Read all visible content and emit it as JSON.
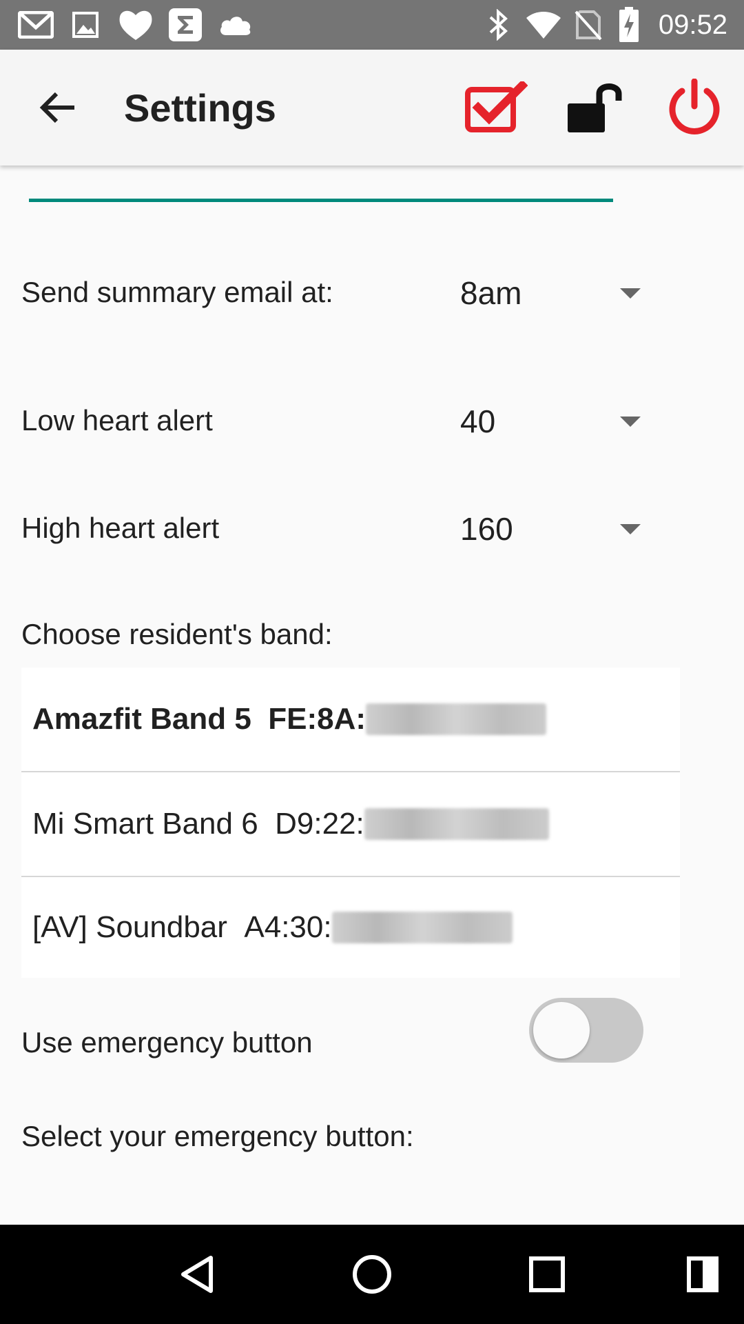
{
  "status_bar": {
    "time": "09:52",
    "left_icons": [
      "gmail-icon",
      "image-icon",
      "heart-app-icon",
      "sigma-app-icon",
      "cloud-icon"
    ],
    "right_icons": [
      "bluetooth-icon",
      "wifi-icon",
      "no-sim-icon",
      "battery-charging-icon"
    ]
  },
  "app_bar": {
    "title": "Settings",
    "actions": [
      "checkbox-checked-icon",
      "unlock-icon",
      "power-icon"
    ],
    "accent_red": "#e5232b"
  },
  "settings": {
    "summary_email": {
      "label": "Send summary email at:",
      "value": "8am"
    },
    "low_heart": {
      "label": "Low heart alert",
      "value": "40"
    },
    "high_heart": {
      "label": "High heart alert",
      "value": "160"
    },
    "band_section_label": "Choose resident's band:",
    "bands": [
      {
        "name": "Amazfit Band 5",
        "mac_prefix": "FE:8A:",
        "selected": true
      },
      {
        "name": "Mi Smart Band 6",
        "mac_prefix": "D9:22:",
        "selected": false
      },
      {
        "name": "[AV] Soundbar",
        "mac_prefix": "A4:30:",
        "selected": false
      }
    ],
    "emergency_toggle": {
      "label": "Use emergency button",
      "on": false
    },
    "emergency_select_label": "Select your emergency button:"
  },
  "colors": {
    "progress_accent": "#00897b",
    "status_bar_bg": "#757575"
  },
  "nav_bar": {
    "buttons": [
      "back-triangle-icon",
      "home-circle-icon",
      "recents-square-icon",
      "split-screen-icon"
    ]
  }
}
